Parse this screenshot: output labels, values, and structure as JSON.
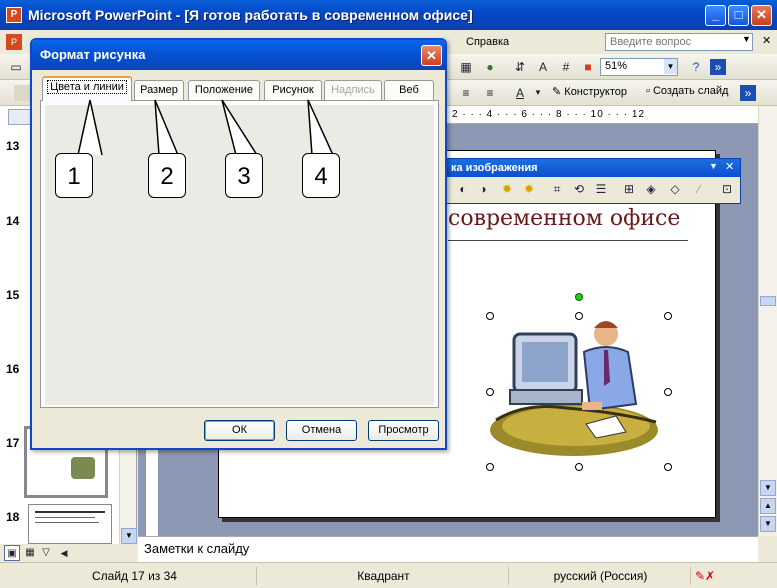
{
  "window": {
    "title": "Microsoft PowerPoint - [Я готов работать в современном офисе]",
    "minimize": "_",
    "maximize": "□",
    "close": "✕"
  },
  "menubar": {
    "help_menu": "Справка",
    "help_search_placeholder": "Введите вопрос"
  },
  "toolbar": {
    "zoom": "51%",
    "design": "Конструктор",
    "new_slide": "Создать слайд"
  },
  "ruler": {
    "ticks": "2 · · · 4 · · · 6 · · · 8 · · · 10 · · · 12"
  },
  "slides_pane": {
    "numbers": [
      "13",
      "14",
      "15",
      "16",
      "17",
      "18"
    ]
  },
  "picture_toolbar": {
    "title": "ка изображения"
  },
  "slide": {
    "title_fragment": "современном офисе"
  },
  "dialog": {
    "title": "Формат рисунка",
    "tabs": [
      "Цвета и линии",
      "Размер",
      "Положение",
      "Рисунок",
      "Надпись",
      "Веб"
    ],
    "ok": "ОК",
    "cancel": "Отмена",
    "preview": "Просмотр"
  },
  "callouts": [
    "1",
    "2",
    "3",
    "4"
  ],
  "notes": {
    "placeholder": "Заметки к слайду"
  },
  "statusbar": {
    "slide": "Слайд 17 из 34",
    "design": "Квадрант",
    "language": "русский (Россия)"
  },
  "colors": {
    "title_bar": "#0a5fd8",
    "slide_title": "#6a1a1a",
    "tab_highlight": "#f0a030"
  }
}
